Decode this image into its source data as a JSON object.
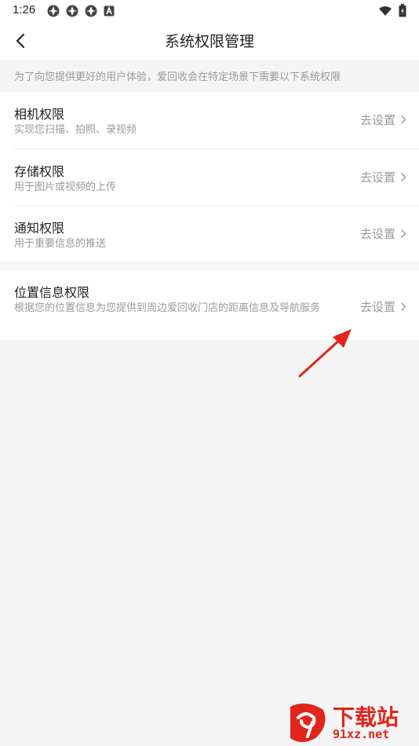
{
  "status_bar": {
    "time": "1:26",
    "icons": [
      "app-notification-icon",
      "app-notification-icon",
      "app-notification-icon",
      "a-icon"
    ],
    "right_icons": [
      "wifi-icon",
      "battery-icon"
    ]
  },
  "nav": {
    "title": "系统权限管理",
    "back_icon": "chevron-left-icon"
  },
  "notice": "为了向您提供更好的用户体验，爱回收会在特定场景下需要以下系统权限",
  "permissions": [
    {
      "title": "相机权限",
      "desc": "实现您扫描、拍照、录视频",
      "action": "去设置"
    },
    {
      "title": "存储权限",
      "desc": "用于图片或视频的上传",
      "action": "去设置"
    },
    {
      "title": "通知权限",
      "desc": "用于重要信息的推送",
      "action": "去设置"
    },
    {
      "title": "位置信息权限",
      "desc": "根据您的位置信息为您提供到周边爱回收门店的距离信息及导航服务",
      "action": "去设置"
    }
  ],
  "watermark": {
    "main": "下载站",
    "sub": "91xz.net",
    "logo_text": "9"
  },
  "colors": {
    "background": "#f5f5f5",
    "card": "#ffffff",
    "text_primary": "#222222",
    "text_secondary": "#9a9a9a",
    "annotation_red": "#e1251b"
  }
}
